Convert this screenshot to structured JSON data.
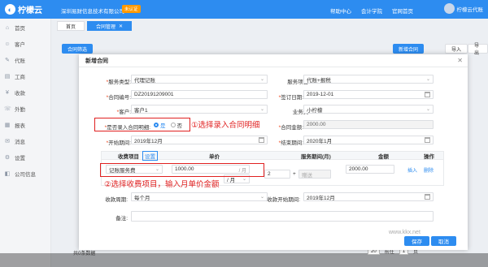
{
  "topbar": {
    "logo": "柠檬云",
    "company": "深圳易财信息技术有限公司",
    "badge": "未认证",
    "nav": [
      "帮助中心",
      "会计学院",
      "官网首页"
    ],
    "user": "柠檬云代账"
  },
  "sidebar": {
    "items": [
      {
        "icon": "⌂",
        "label": "首页"
      },
      {
        "icon": "☺",
        "label": "客户"
      },
      {
        "icon": "✎",
        "label": "代账"
      },
      {
        "icon": "▤",
        "label": "工商"
      },
      {
        "icon": "¥",
        "label": "收款"
      },
      {
        "icon": "☏",
        "label": "外勤"
      },
      {
        "icon": "▦",
        "label": "报表"
      },
      {
        "icon": "✉",
        "label": "消息"
      },
      {
        "icon": "⚙",
        "label": "设置"
      },
      {
        "icon": "◧",
        "label": "公司信息"
      }
    ]
  },
  "tabs": [
    {
      "label": "首页",
      "active": false
    },
    {
      "label": "合同管理",
      "active": true,
      "close": "✕"
    }
  ],
  "page": {
    "filter_btn": "合同筛选",
    "new_btn": "新增合同",
    "import_btn": "导入",
    "export_btn": "导出",
    "total": "共0条数据",
    "page_size": "20",
    "go_label": "前往",
    "page_num": "1",
    "page_unit": "页"
  },
  "modal": {
    "title": "新增合同",
    "close": "✕",
    "fields": {
      "service_type": {
        "label": "服务类型:",
        "value": "代理记账"
      },
      "service_item": {
        "label": "服务项目:",
        "value": "代账+报税"
      },
      "contract_no": {
        "label": "合同编号:",
        "value": "DZ20191209001"
      },
      "sign_date": {
        "label": "签订日期:",
        "value": "2019-12-01"
      },
      "customer": {
        "label": "客户:",
        "value": "客户1"
      },
      "salesperson": {
        "label": "业务员:",
        "value": "小柠檬"
      },
      "entry_detail": {
        "label": "是否录入合同明细:",
        "yes": "是",
        "no": "否"
      },
      "amount": {
        "label": "合同金额:",
        "value": "2000.00"
      },
      "start_period": {
        "label": "开始期间:",
        "value": "2019年12月"
      },
      "end_period": {
        "label": "结束期间:",
        "value": "2020年1月"
      },
      "collect_cycle": {
        "label": "收款周期:",
        "value": "每个月"
      },
      "collect_start": {
        "label": "收款开始期间:",
        "value": "2019年12月"
      },
      "remark": {
        "label": "备注:",
        "value": ""
      }
    },
    "table": {
      "headers": [
        "收费项目",
        "设置",
        "单价",
        "服务期间(月)",
        "金额",
        "操作"
      ],
      "row": {
        "item": "记账服务费",
        "price": "1000.00",
        "price_unit": "/ 月",
        "unit_select": "/ 月",
        "months": "2",
        "plus": "+",
        "gift_placeholder": "赠送",
        "amount": "2000.00",
        "insert": "插入",
        "delete": "删除"
      }
    },
    "annotations": {
      "a1": "①选择录入合同明细",
      "a2": "②选择收费项目，输入月单价金额"
    },
    "save_btn": "保存",
    "cancel_btn": "取消"
  },
  "watermark": "www.kkx.net",
  "colors": {
    "primary": "#2d8cf0",
    "annotation": "#e02020",
    "badge": "#ff9900"
  }
}
